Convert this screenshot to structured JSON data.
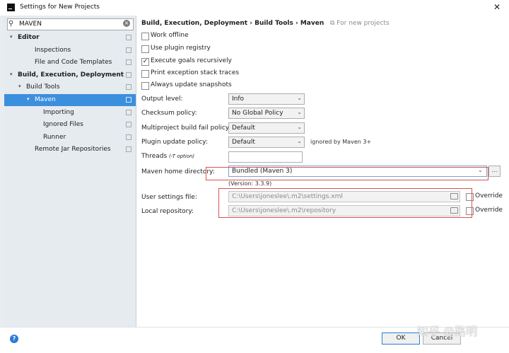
{
  "window": {
    "title": "Settings for New Projects"
  },
  "search": {
    "value": "MAVEN"
  },
  "tree": [
    {
      "label": "Editor",
      "bold": true,
      "arrow": "▾",
      "indent": 0
    },
    {
      "label": "Inspections",
      "bold": false,
      "arrow": "",
      "indent": 2
    },
    {
      "label": "File and Code Templates",
      "bold": false,
      "arrow": "",
      "indent": 2
    },
    {
      "label": "Build, Execution, Deployment",
      "bold": true,
      "arrow": "▾",
      "indent": 0
    },
    {
      "label": "Build Tools",
      "bold": false,
      "arrow": "▾",
      "indent": 1
    },
    {
      "label": "Maven",
      "bold": false,
      "arrow": "▾",
      "indent": 2,
      "selected": true
    },
    {
      "label": "Importing",
      "bold": false,
      "arrow": "",
      "indent": 3
    },
    {
      "label": "Ignored Files",
      "bold": false,
      "arrow": "",
      "indent": 3
    },
    {
      "label": "Runner",
      "bold": false,
      "arrow": "",
      "indent": 3
    },
    {
      "label": "Remote Jar Repositories",
      "bold": false,
      "arrow": "",
      "indent": 2
    }
  ],
  "breadcrumb": {
    "path": "Build, Execution, Deployment  ›  Build Tools  ›  Maven",
    "note": "For new projects"
  },
  "checkboxes": [
    {
      "label": "Work offline",
      "checked": false
    },
    {
      "label": "Use plugin registry",
      "checked": false
    },
    {
      "label": "Execute goals recursively",
      "checked": true
    },
    {
      "label": "Print exception stack traces",
      "checked": false
    },
    {
      "label": "Always update snapshots",
      "checked": false
    }
  ],
  "fields": {
    "output_level": {
      "label": "Output level:",
      "value": "Info"
    },
    "checksum_policy": {
      "label": "Checksum policy:",
      "value": "No Global Policy"
    },
    "multiproject_fail_policy": {
      "label": "Multiproject build fail policy:",
      "value": "Default"
    },
    "plugin_update_policy": {
      "label": "Plugin update policy:",
      "value": "Default",
      "note": "ignored by Maven 3+"
    },
    "threads": {
      "label": "Threads",
      "hint": "(-T option)",
      "value": ""
    },
    "maven_home": {
      "label": "Maven home directory:",
      "value": "Bundled (Maven 3)",
      "browse": "..."
    },
    "version": {
      "text": "(Version: 3.3.9)"
    },
    "user_settings": {
      "label": "User settings file:",
      "value": "C:\\Users\\joneslee\\.m2\\settings.xml",
      "override": "Override"
    },
    "local_repo": {
      "label": "Local repository:",
      "value": "C:\\Users\\joneslee\\.m2\\repository",
      "override": "Override"
    }
  },
  "buttons": {
    "ok": "OK",
    "cancel": "Cancel"
  },
  "watermark": "知乎 @路明",
  "colors": {
    "selection": "#3c8fdc",
    "highlight_box": "#d9534f",
    "help": "#2b7bd8"
  }
}
